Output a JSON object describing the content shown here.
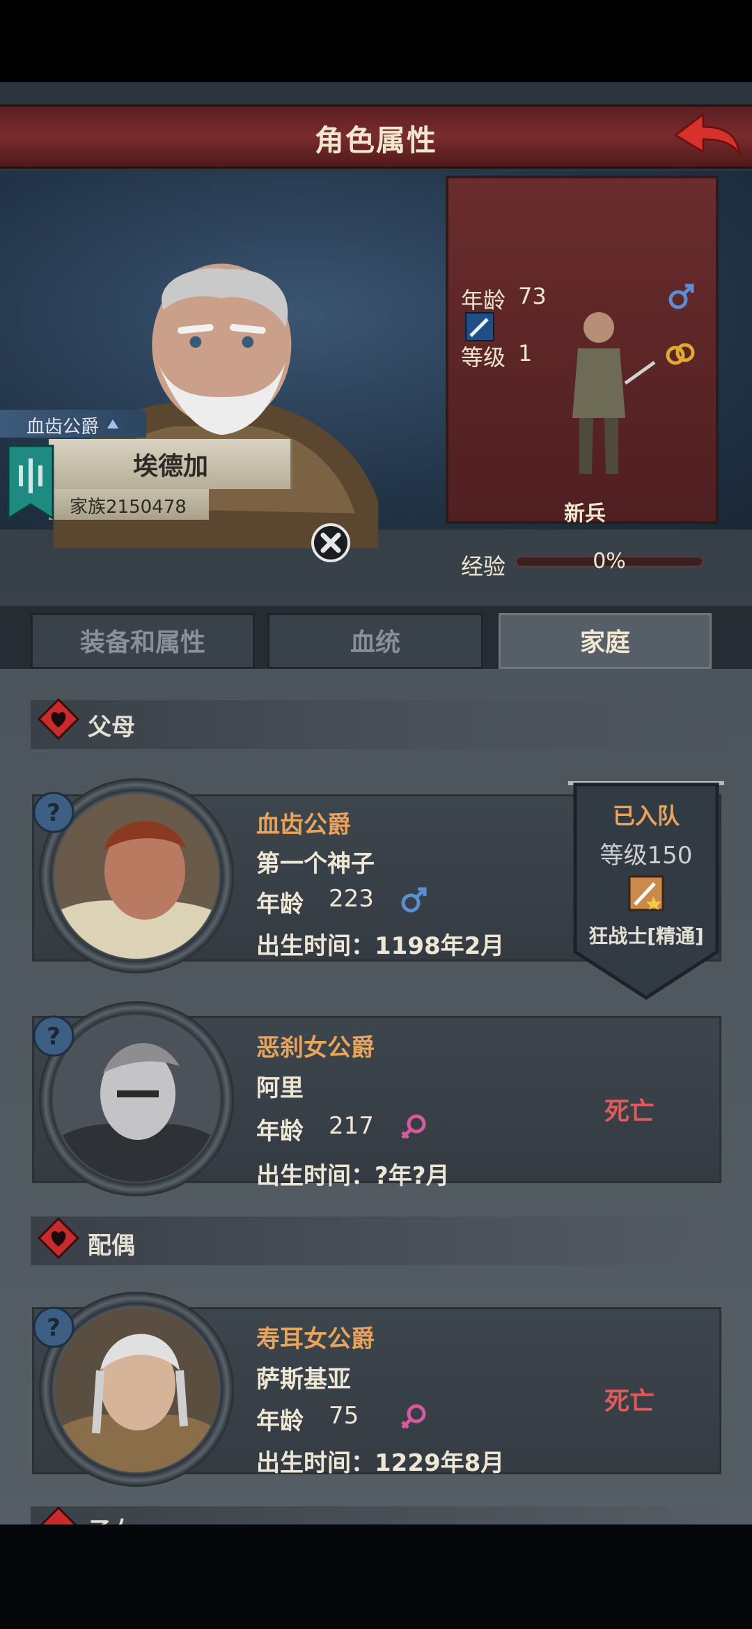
{
  "header": {
    "title": "角色属性"
  },
  "character": {
    "title": "血齿公爵",
    "name": "埃德加",
    "family": "家族2150478",
    "stats": {
      "age_label": "年龄",
      "age_value": "73",
      "level_label": "等级",
      "level_value": "1",
      "unit_name": "新兵",
      "exp_label": "经验",
      "exp_value": "0%",
      "exp_fraction": 0
    }
  },
  "tabs": [
    {
      "label": "装备和属性",
      "active": false
    },
    {
      "label": "血统",
      "active": false
    },
    {
      "label": "家庭",
      "active": true
    }
  ],
  "sections": {
    "parents": "父母",
    "spouse": "配偶",
    "children": "子女"
  },
  "members": [
    {
      "title": "血齿公爵",
      "name": "第一个神子",
      "age_label": "年龄",
      "age": "223",
      "gender": "male-icon",
      "birth": "出生时间：1198年2月"
    },
    {
      "title": "恶刹女公爵",
      "name": "阿里",
      "age_label": "年龄",
      "age": "217",
      "gender": "female-icon",
      "birth": "出生时间：?年?月",
      "status": "死亡"
    },
    {
      "title": "寿耳女公爵",
      "name": "萨斯基亚",
      "age_label": "年龄",
      "age": "75",
      "gender": "female-icon",
      "birth": "出生时间：1229年8月",
      "status": "死亡"
    }
  ],
  "pennant": {
    "status": "已入队",
    "level_label": "等级",
    "level_value": "150",
    "class": "狂战士[精通]"
  },
  "colors": {
    "accent_name": "#e9a35a",
    "dead": "#e05a5a",
    "header": "#7a2b2d",
    "male": "#5b8fd1",
    "female": "#d75a9e"
  }
}
